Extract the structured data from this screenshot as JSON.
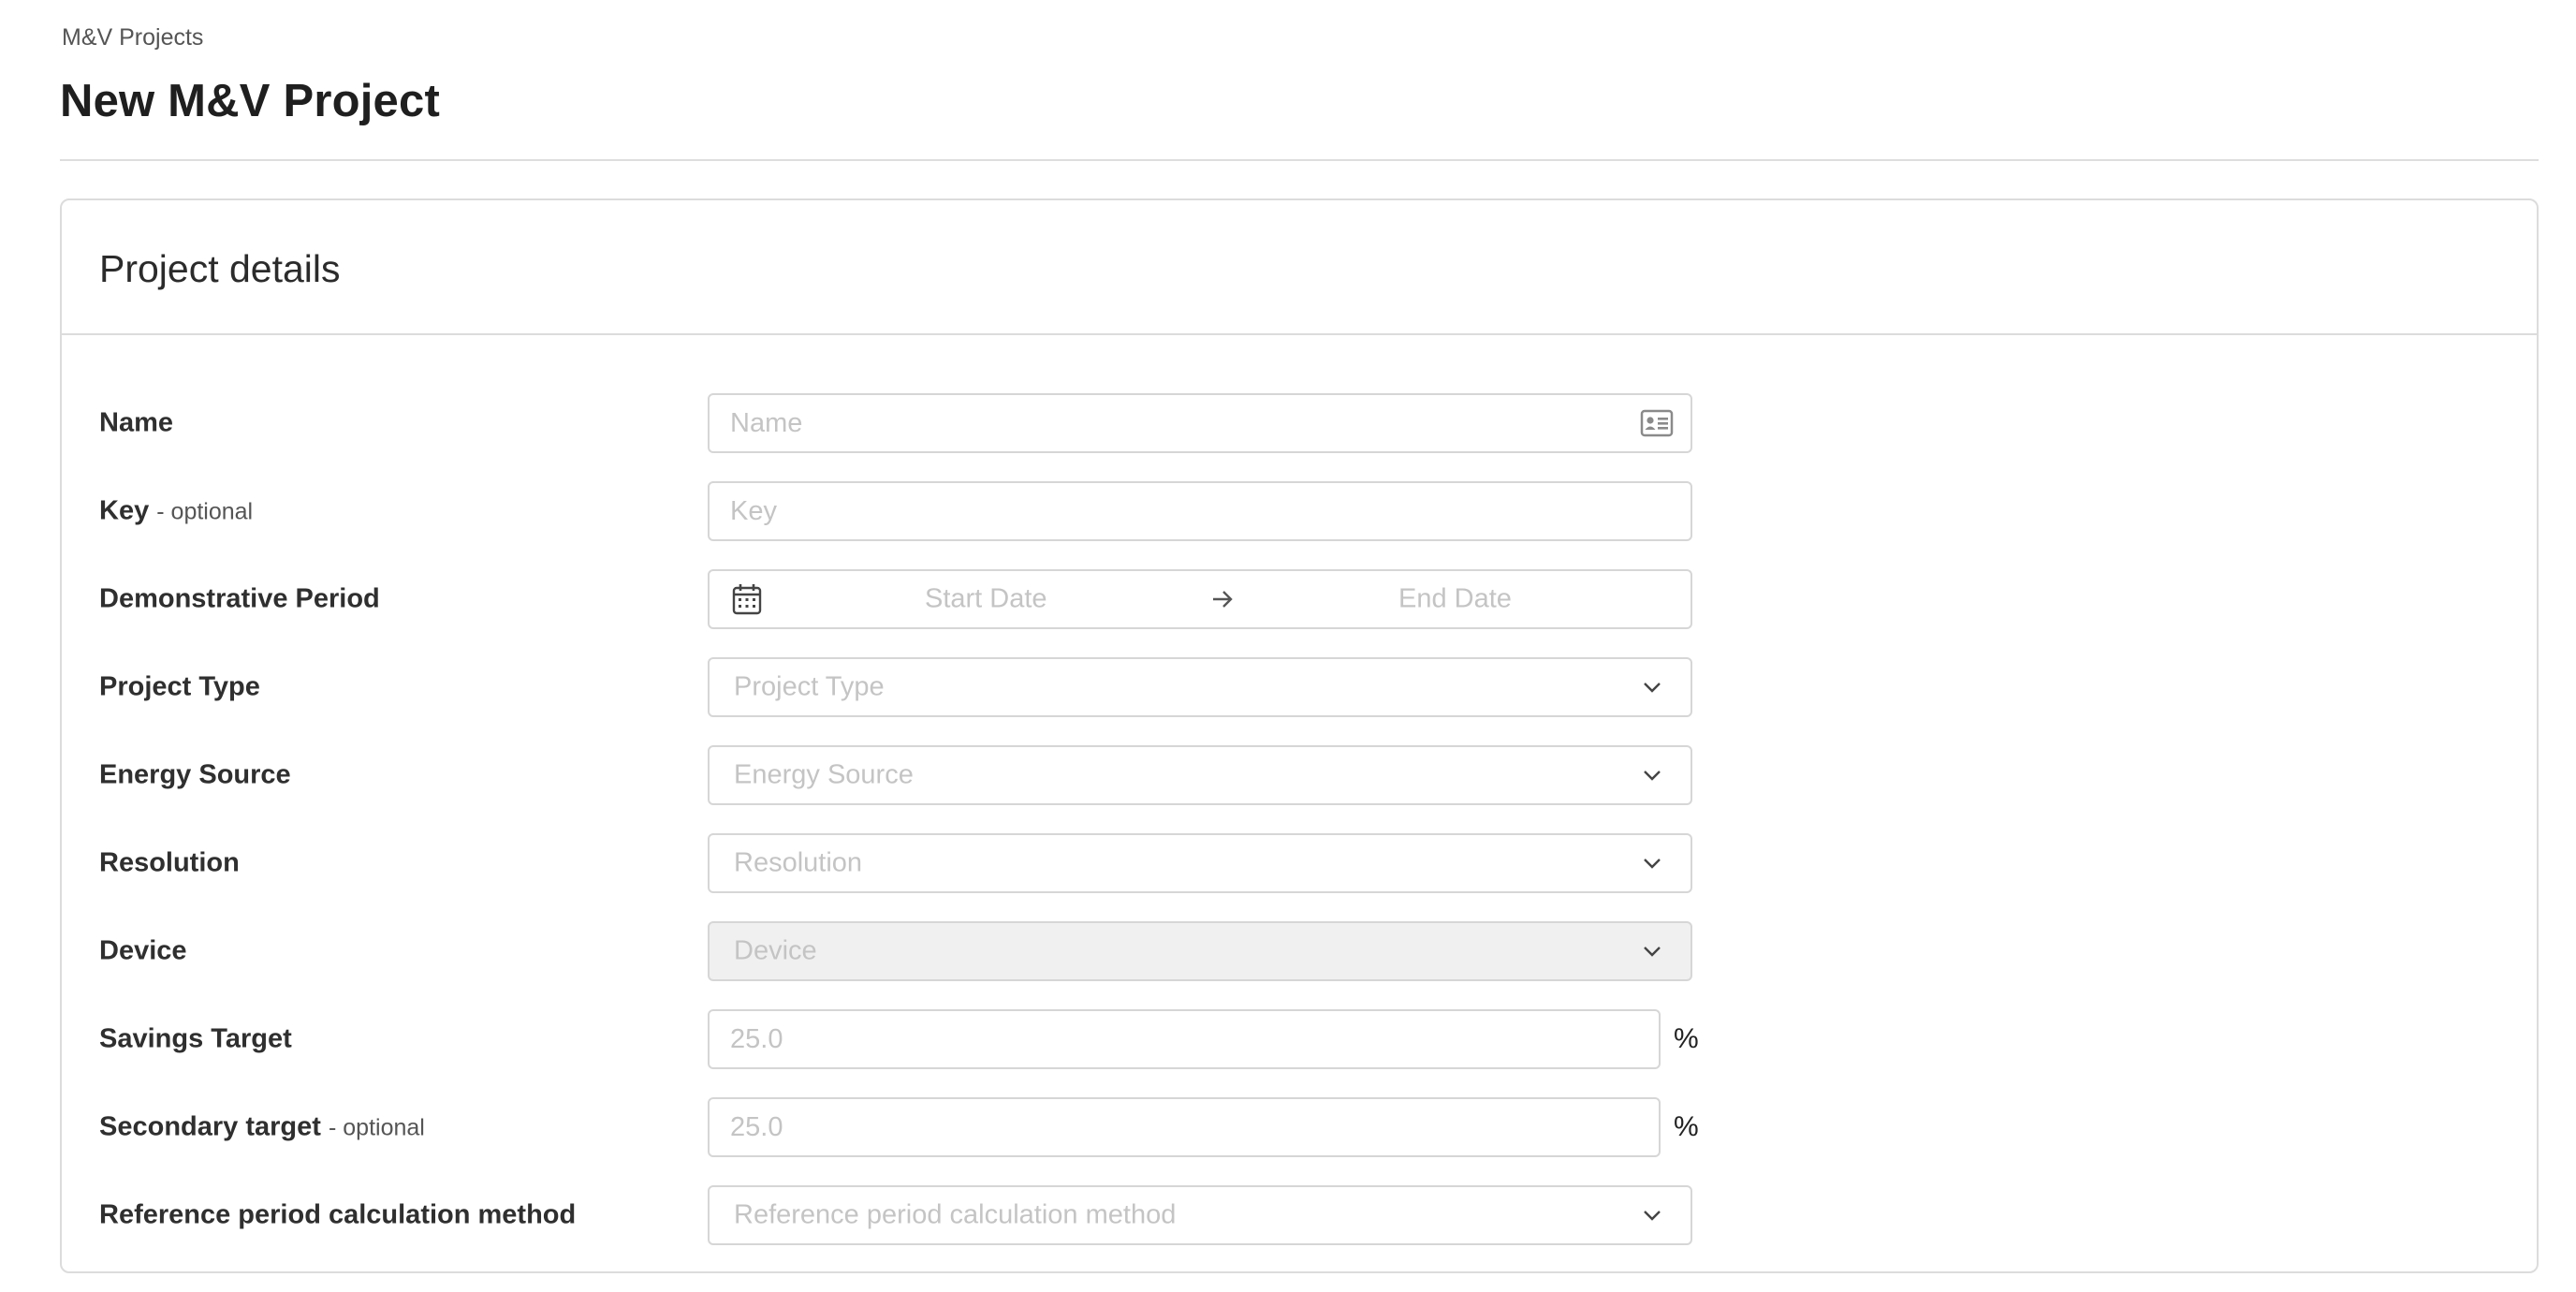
{
  "breadcrumb": "M&V Projects",
  "page_title": "New M&V Project",
  "card_title": "Project details",
  "fields": {
    "name": {
      "label": "Name",
      "placeholder": "Name",
      "icon": "contact-card-icon"
    },
    "key": {
      "label": "Key",
      "optional": "- optional",
      "placeholder": "Key"
    },
    "period": {
      "label": "Demonstrative Period",
      "start_placeholder": "Start Date",
      "end_placeholder": "End Date"
    },
    "project_type": {
      "label": "Project Type",
      "placeholder": "Project Type"
    },
    "energy_source": {
      "label": "Energy Source",
      "placeholder": "Energy Source"
    },
    "resolution": {
      "label": "Resolution",
      "placeholder": "Resolution"
    },
    "device": {
      "label": "Device",
      "placeholder": "Device",
      "disabled": true
    },
    "savings_target": {
      "label": "Savings Target",
      "placeholder": "25.0",
      "unit": "%"
    },
    "secondary_target": {
      "label": "Secondary target",
      "optional": "- optional",
      "placeholder": "25.0",
      "unit": "%"
    },
    "reference_method": {
      "label": "Reference period calculation method",
      "placeholder": "Reference period calculation method"
    }
  },
  "colors": {
    "placeholder": "#c4c4c4",
    "border": "#d6d6d6",
    "disabled_bg": "#f0f0f0"
  }
}
